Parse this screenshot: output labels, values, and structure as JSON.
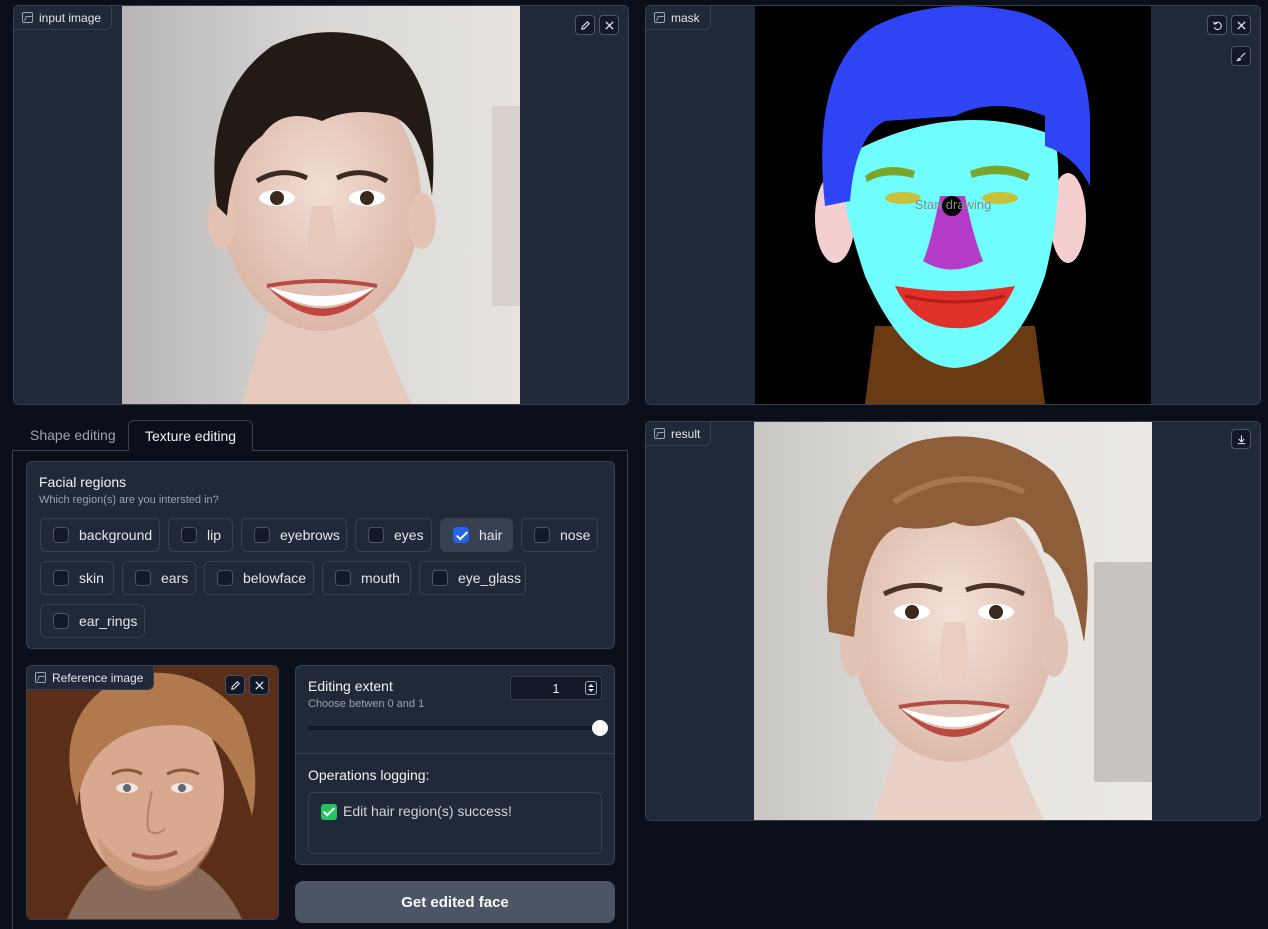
{
  "input_panel": {
    "label": "input image"
  },
  "mask_panel": {
    "label": "mask",
    "hint": "Start drawing"
  },
  "result_panel": {
    "label": "result"
  },
  "tabs": [
    {
      "label": "Shape editing",
      "active": false
    },
    {
      "label": "Texture editing",
      "active": true
    }
  ],
  "facial_regions": {
    "title": "Facial regions",
    "subtitle": "Which region(s) are you intersted in?",
    "options": [
      {
        "label": "background",
        "checked": false
      },
      {
        "label": "lip",
        "checked": false
      },
      {
        "label": "eyebrows",
        "checked": false
      },
      {
        "label": "eyes",
        "checked": false
      },
      {
        "label": "hair",
        "checked": true
      },
      {
        "label": "nose",
        "checked": false
      },
      {
        "label": "skin",
        "checked": false
      },
      {
        "label": "ears",
        "checked": false
      },
      {
        "label": "belowface",
        "checked": false
      },
      {
        "label": "mouth",
        "checked": false
      },
      {
        "label": "eye_glass",
        "checked": false
      },
      {
        "label": "ear_rings",
        "checked": false
      }
    ]
  },
  "reference_panel": {
    "label": "Reference image"
  },
  "editing_extent": {
    "title": "Editing extent",
    "subtitle": "Choose betwen 0 and 1",
    "value": "1",
    "slider_fraction": 1.0
  },
  "logging": {
    "title": "Operations logging:",
    "message": "Edit hair region(s) success!"
  },
  "submit_button": {
    "label": "Get edited face"
  },
  "colors": {
    "mask_hair": "#2f45f5",
    "mask_skin": "#6ffdfd",
    "mask_nose": "#b43cc8",
    "mask_lips": "#e0302a",
    "mask_brows": "#7aa52a",
    "mask_eyes": "#c8c23a",
    "mask_neck": "#6a3a12",
    "mask_ears": "#f5cfd0",
    "accent": "#2563eb"
  }
}
